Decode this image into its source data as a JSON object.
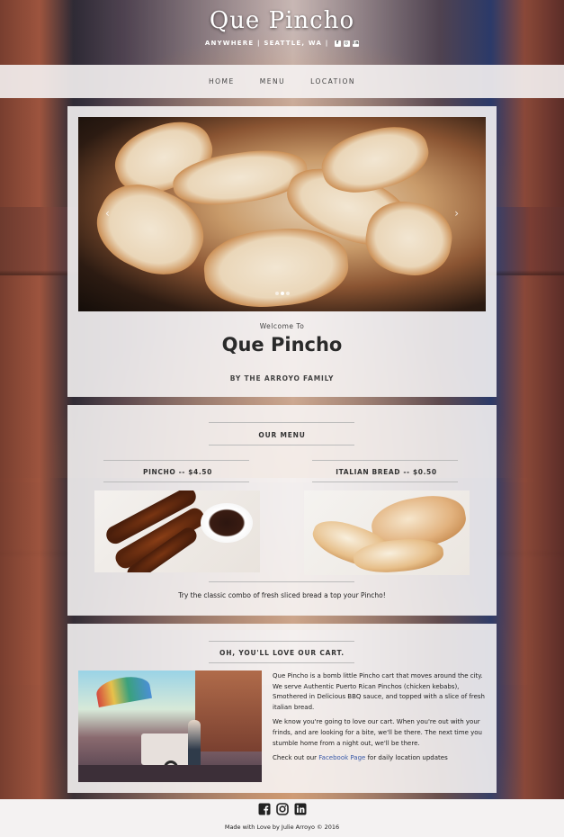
{
  "header": {
    "title": "Que Pincho",
    "tagline": "ANYWHERE | SEATTLE, WA |",
    "social_icons": [
      "facebook-icon",
      "instagram-icon",
      "linkedin-icon"
    ]
  },
  "nav": {
    "items": [
      {
        "label": "HOME"
      },
      {
        "label": "MENU"
      },
      {
        "label": "LOCATION"
      }
    ]
  },
  "hero": {
    "prev_arrow": "‹",
    "next_arrow": "›",
    "welcome": "Welcome To",
    "title": "Que Pincho",
    "byline": "BY THE ARROYO FAMILY",
    "slides": 3,
    "active_slide": 2
  },
  "menu": {
    "title": "OUR MENU",
    "items": [
      {
        "label": "PINCHO -- $4.50"
      },
      {
        "label": "ITALIAN BREAD -- $0.50"
      }
    ],
    "combo": "Try the classic combo of fresh sliced bread a top your Pincho!"
  },
  "about": {
    "title_pre": "OH, YOU'LL ",
    "title_em": "LOVE",
    "title_post": " OUR CART.",
    "p1": "Que Pincho is a bomb little Pincho cart that moves around the city. We serve Authentic Puerto Rican Pinchos (chicken kebabs), Smothered in Delicious BBQ sauce, and topped with a slice of fresh italian bread.",
    "p2": "We know you're going to love our cart. When you're out with your frinds, and are looking for a bite, we'll be there. The next time you stumble home from a night out, we'll be there.",
    "p3_pre": "Check out our ",
    "p3_link": "Facebook Page",
    "p3_post": " for daily location updates"
  },
  "footer": {
    "icons": [
      "facebook-icon",
      "instagram-icon",
      "linkedin-icon"
    ],
    "credit": "Made with Love by Julie Arroyo © 2016"
  },
  "colors": {
    "nav_bg": "#f4f2f2",
    "panel_bg": "#f8f6f6",
    "link": "#3a5aa8"
  }
}
